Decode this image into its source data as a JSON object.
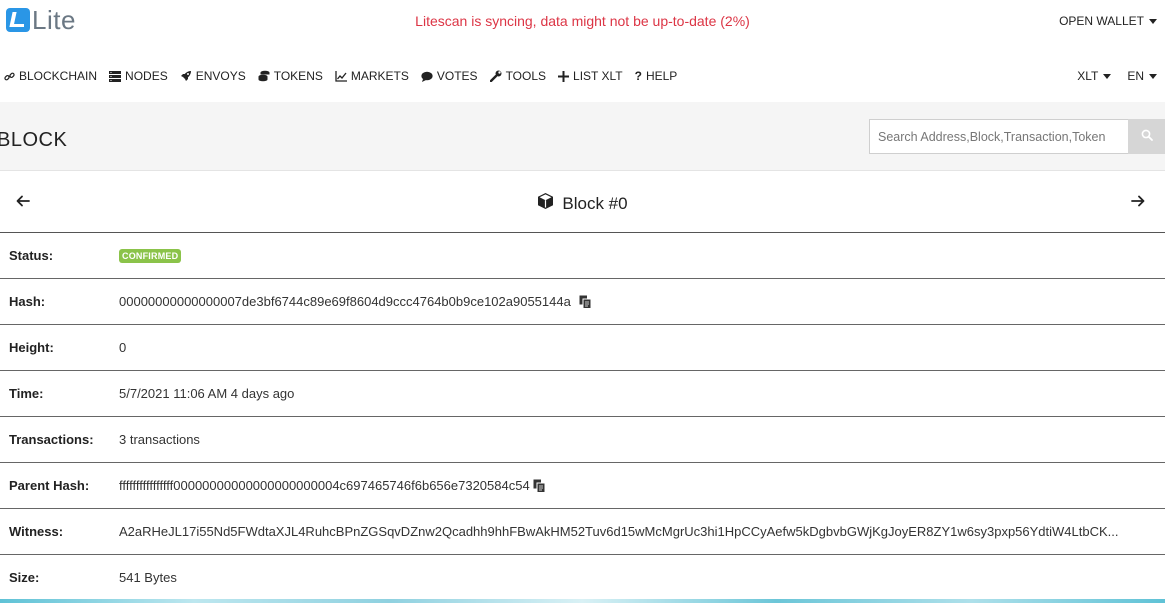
{
  "app": {
    "logo_text": "Lite"
  },
  "banner": {
    "sync_message": "Litescan is syncing, data might not be up-to-date (2%)"
  },
  "header": {
    "open_wallet": "OPEN WALLET"
  },
  "nav": {
    "items": [
      {
        "label": "BLOCKCHAIN",
        "icon": "link-icon"
      },
      {
        "label": "NODES",
        "icon": "server-icon"
      },
      {
        "label": "ENVOYS",
        "icon": "rocket-icon"
      },
      {
        "label": "TOKENS",
        "icon": "coins-icon"
      },
      {
        "label": "MARKETS",
        "icon": "chart-icon"
      },
      {
        "label": "VOTES",
        "icon": "comment-icon"
      },
      {
        "label": "TOOLS",
        "icon": "wrench-icon"
      },
      {
        "label": "LIST XLT",
        "icon": "plus-icon"
      },
      {
        "label": "HELP",
        "icon": "question-icon"
      }
    ],
    "currency": "XLT",
    "language": "EN"
  },
  "page": {
    "title": "BLOCK",
    "search_placeholder": "Search Address,Block,Transaction,Token"
  },
  "block": {
    "title": "Block #0",
    "rows": {
      "status": {
        "label": "Status:",
        "value": "CONFIRMED"
      },
      "hash": {
        "label": "Hash:",
        "value": "00000000000000007de3bf6744c89e69f8604d9ccc4764b0b9ce102a9055144a"
      },
      "height": {
        "label": "Height:",
        "value": "0"
      },
      "time": {
        "label": "Time:",
        "value": "5/7/2021 11:06 AM 4 days ago"
      },
      "transactions": {
        "label": "Transactions:",
        "value": "3 transactions"
      },
      "parent_hash": {
        "label": "Parent Hash:",
        "value": "ffffffffffffffff00000000000000000000004c697465746f6b656e7320584c54"
      },
      "witness": {
        "label": "Witness:",
        "value": "A2aRHeJL17i55Nd5FWdtaXJL4RuhcBPnZGSqvDZnw2Qcadhh9hhFBwAkHM52Tuv6d15wMcMgrUc3hi1HpCCyAefw5kDgbvbGWjKgJoyER8ZY1w6sy3pxp56YdtiW4LtbCK..."
      },
      "size": {
        "label": "Size:",
        "value": "541 Bytes"
      }
    }
  },
  "colors": {
    "accent": "#2a96e6",
    "warning_text": "#dc3545",
    "badge_green": "#8bc34a"
  }
}
